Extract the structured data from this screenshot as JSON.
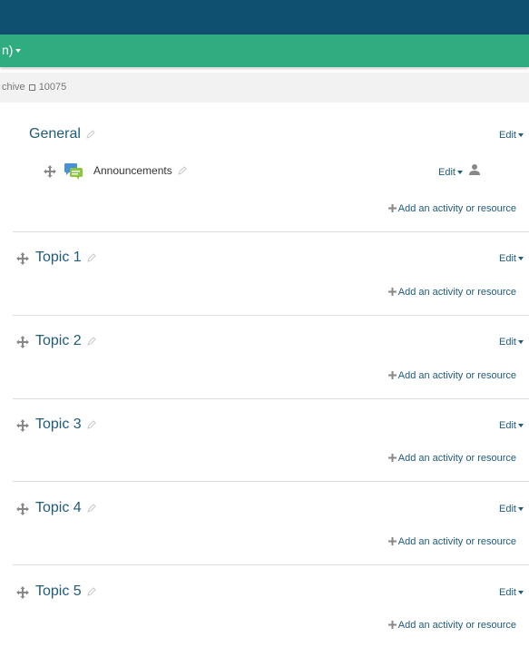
{
  "header": {
    "language_menu_label": "n)"
  },
  "breadcrumb": {
    "item1": "chive",
    "item2": "10075"
  },
  "sections": [
    {
      "title": "General",
      "has_move": false,
      "edit_label": "Edit",
      "add_label": "Add an activity or resource"
    },
    {
      "title": "Topic 1",
      "has_move": true,
      "edit_label": "Edit",
      "add_label": "Add an activity or resource"
    },
    {
      "title": "Topic 2",
      "has_move": true,
      "edit_label": "Edit",
      "add_label": "Add an activity or resource"
    },
    {
      "title": "Topic 3",
      "has_move": true,
      "edit_label": "Edit",
      "add_label": "Add an activity or resource"
    },
    {
      "title": "Topic 4",
      "has_move": true,
      "edit_label": "Edit",
      "add_label": "Add an activity or resource"
    },
    {
      "title": "Topic 5",
      "has_move": true,
      "edit_label": "Edit",
      "add_label": "Add an activity or resource"
    }
  ],
  "activity": {
    "name": "Announcements",
    "edit_label": "Edit",
    "icon": "forum-icon"
  },
  "colors": {
    "topbar": "#0f5070",
    "navbar": "#2fad80",
    "link": "#1f5b7a"
  }
}
